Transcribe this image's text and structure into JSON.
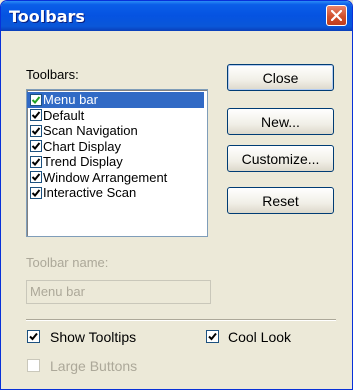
{
  "window": {
    "title": "Toolbars"
  },
  "toolbars_label": "Toolbars:",
  "toolbars": [
    {
      "label": "Menu bar",
      "checked": true,
      "selected": true
    },
    {
      "label": "Default",
      "checked": true
    },
    {
      "label": "Scan Navigation",
      "checked": true
    },
    {
      "label": "Chart Display",
      "checked": true
    },
    {
      "label": "Trend Display",
      "checked": true
    },
    {
      "label": "Window Arrangement",
      "checked": true
    },
    {
      "label": "Interactive Scan",
      "checked": true
    }
  ],
  "buttons": {
    "close": "Close",
    "new": "New...",
    "customize": "Customize...",
    "reset": "Reset"
  },
  "toolbar_name": {
    "label": "Toolbar name:",
    "value": "Menu bar",
    "enabled": false
  },
  "options": {
    "show_tooltips": {
      "label": "Show Tooltips",
      "checked": true
    },
    "cool_look": {
      "label": "Cool Look",
      "checked": true
    },
    "large_buttons": {
      "label": "Large Buttons",
      "checked": false,
      "enabled": false
    }
  },
  "colors": {
    "titlebar": "#0553e1",
    "selection": "#316ac5",
    "close_button": "#d1502c",
    "face": "#ece9d8"
  }
}
